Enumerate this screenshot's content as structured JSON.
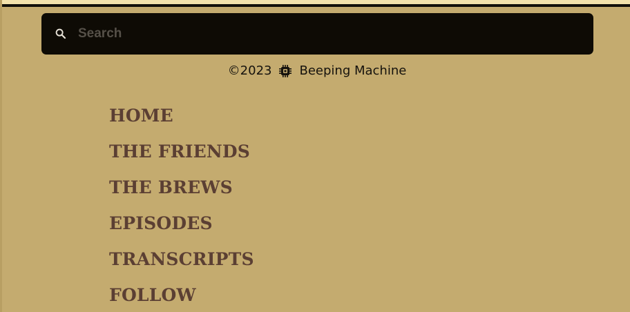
{
  "search": {
    "placeholder": "Search",
    "value": "",
    "icon": "search-icon"
  },
  "footer": {
    "copyright": "©2023",
    "brand_icon": "chip-icon",
    "brand": "Beeping Machine"
  },
  "nav": {
    "items": [
      {
        "label": "HOME"
      },
      {
        "label": "THE FRIENDS"
      },
      {
        "label": "THE BREWS"
      },
      {
        "label": "EPISODES"
      },
      {
        "label": "TRANSCRIPTS"
      },
      {
        "label": "FOLLOW"
      }
    ]
  },
  "colors": {
    "background": "#c4ab6f",
    "search_bg": "#0e0b05",
    "nav_text": "#5b3f33",
    "top_strip": "#f3e2ad"
  }
}
